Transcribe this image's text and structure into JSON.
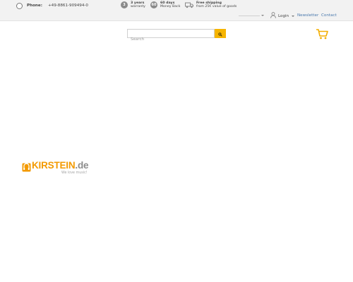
{
  "topbar": {
    "phone_label": "Phone:",
    "phone_number": "+49-8861-909494-0",
    "usps": [
      {
        "icon": "3",
        "line1": "3 years",
        "line2": "warranty"
      },
      {
        "icon": "60",
        "line1": "60 days",
        "line2": "Money Back"
      },
      {
        "icon": "truck-icon",
        "line1": "Free shipping",
        "line2": "from 25€ value of goods"
      }
    ],
    "login_label": "Login",
    "links": {
      "newsletter": "Newsletter",
      "contact": "Contact"
    }
  },
  "search": {
    "placeholder": "Search",
    "button_icon": "search-icon"
  },
  "cart": {
    "icon": "shopping-cart-icon"
  },
  "logo": {
    "brand": "KIRSTEIN",
    "domain": ".de",
    "slogan": "We love music!"
  },
  "colors": {
    "accent": "#f6b400",
    "logo_orange": "#f39a00",
    "topbar_bg": "#f2f2f2",
    "link_blue": "#4a79ad"
  }
}
